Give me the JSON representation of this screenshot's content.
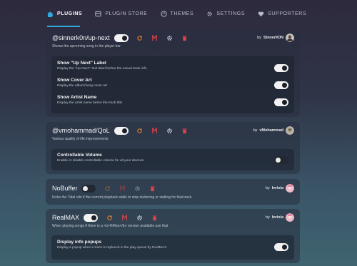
{
  "tabs": [
    {
      "label": "PLUGINS",
      "icon": "puzzle-icon",
      "active": true
    },
    {
      "label": "PLUGIN STORE",
      "icon": "store-icon"
    },
    {
      "label": "THEMES",
      "icon": "palette-icon"
    },
    {
      "label": "SETTINGS",
      "icon": "gear-icon"
    },
    {
      "label": "SUPPORTERS",
      "icon": "heart-icon"
    }
  ],
  "colors": {
    "accent": "#2fa9e0",
    "reload": "#e2802a",
    "github": "#e0424a",
    "delete": "#e0424a"
  },
  "plugins": [
    {
      "name": "@sinnerk0n/up-next",
      "enabled": true,
      "author_prefix": "by",
      "author": "SinnerK0N",
      "description": "Shows the upcoming song in the player bar",
      "settings": [
        {
          "title": "Show \"Up Next\" Label",
          "description": "Display the \"Up Next:\" text label before the actual track info",
          "enabled": true
        },
        {
          "title": "Show Cover Art",
          "description": "Display the album/song cover art",
          "enabled": true
        },
        {
          "title": "Show Artist Name",
          "description": "Display the artist name below the track title",
          "enabled": true
        }
      ]
    },
    {
      "name": "@vmohammad/QoL",
      "enabled": true,
      "author_prefix": "by",
      "author": "vMohammad",
      "description": "Various quality of life improvements",
      "settings": [
        {
          "title": "Controllable Volume",
          "description": "Enable or disable controllable volume for all your devices",
          "enabled": false
        }
      ]
    },
    {
      "name": "NoBuffer",
      "enabled": false,
      "author_prefix": "by",
      "author": "Inrixia",
      "description": "Kicks the Tidal cdn if the current playback stalls to stop stuttering or stalling for that track",
      "settings": []
    },
    {
      "name": "RealMAX",
      "enabled": true,
      "author_prefix": "by",
      "author": "Inrixia",
      "description": "When playing songs if there is a <b>HiRes</b> version available use that",
      "settings": [
        {
          "title": "Display info popups",
          "description": "Display a popup when a track is replaced in the play queue by RealMAX",
          "enabled": true
        }
      ]
    }
  ]
}
